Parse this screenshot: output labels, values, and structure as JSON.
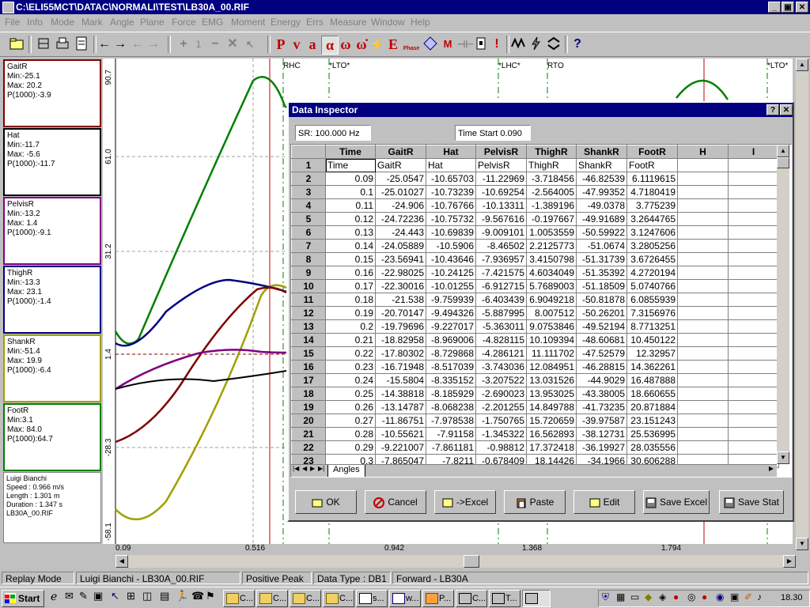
{
  "window": {
    "title": "C:\\ELI55MCT\\DATAC\\NORMALI\\TEST\\LB30A_00.RIF"
  },
  "menu": [
    "File",
    "Info",
    "Mode",
    "Mark",
    "Angle",
    "Plane",
    "Force",
    "EMG",
    "Moment",
    "Energy",
    "Errs",
    "Measure",
    "Window",
    "Help"
  ],
  "toolbar": {
    "step_value": "1",
    "tools": [
      "P",
      "v",
      "a",
      "α",
      "ω",
      "ω̇",
      "E",
      "Phase",
      "M",
      "?"
    ]
  },
  "legend": [
    {
      "name": "GaitR",
      "min": "Min:-25.1",
      "max": "Max: 20.2",
      "p": "P(1000):-3.9",
      "color": "#800000"
    },
    {
      "name": "Hat",
      "min": "Min:-11.7",
      "max": "Max: -5.6",
      "p": "P(1000):-11.7",
      "color": "#000000"
    },
    {
      "name": "PelvisR",
      "min": "Min:-13.2",
      "max": "Max: 1.4",
      "p": "P(1000):-9.1",
      "color": "#800080"
    },
    {
      "name": "ThighR",
      "min": "Min:-13.3",
      "max": "Max: 23.1",
      "p": "P(1000):-1.4",
      "color": "#000080"
    },
    {
      "name": "ShankR",
      "min": "Min:-51.4",
      "max": "Max: 19.9",
      "p": "P(1000):-6.4",
      "color": "#808000"
    },
    {
      "name": "FootR",
      "min": "Min:3.1",
      "max": "Max: 84.0",
      "p": "P(1000):64.7",
      "color": "#008000"
    }
  ],
  "subject": {
    "name": "Luigi Bianchi",
    "speed": "Speed : 0.966 m/s",
    "length": "Length : 1.301 m",
    "duration": "Duration : 1.347 s",
    "file": "LB30A_00.RIF"
  },
  "plot": {
    "y_ticks": [
      "90.7",
      "61.0",
      "31.2",
      "1.4",
      "-28.3",
      "-58.1"
    ],
    "x_ticks": [
      "0.09",
      "0.516",
      "0.942",
      "1.368",
      "1.794"
    ],
    "events": [
      "RHC",
      "*LTO*",
      "*LHC*",
      "RTO",
      "*LTO*"
    ]
  },
  "dialog": {
    "title": "Data Inspector",
    "sr": "SR: 100.000 Hz",
    "time_start": "Time Start 0.090",
    "columns": [
      "",
      "Time",
      "GaitR",
      "Hat",
      "PelvisR",
      "ThighR",
      "ShankR",
      "FootR",
      "H",
      "I"
    ],
    "header_row": [
      "Time",
      "GaitR",
      "Hat",
      "PelvisR",
      "ThighR",
      "ShankR",
      "FootR",
      "",
      ""
    ],
    "rows": [
      [
        "0.09",
        "-25.0547",
        "-10.65703",
        "-11.22969",
        "-3.718456",
        "-46.82539",
        "6.1119615"
      ],
      [
        "0.1",
        "-25.01027",
        "-10.73239",
        "-10.69254",
        "-2.564005",
        "-47.99352",
        "4.7180419"
      ],
      [
        "0.11",
        "-24.906",
        "-10.76766",
        "-10.13311",
        "-1.389196",
        "-49.0378",
        "3.775239"
      ],
      [
        "0.12",
        "-24.72236",
        "-10.75732",
        "-9.567616",
        "-0.197667",
        "-49.91689",
        "3.2644765"
      ],
      [
        "0.13",
        "-24.443",
        "-10.69839",
        "-9.009101",
        "1.0053559",
        "-50.59922",
        "3.1247606"
      ],
      [
        "0.14",
        "-24.05889",
        "-10.5906",
        "-8.46502",
        "2.2125773",
        "-51.0674",
        "3.2805256"
      ],
      [
        "0.15",
        "-23.56941",
        "-10.43646",
        "-7.936957",
        "3.4150798",
        "-51.31739",
        "3.6726455"
      ],
      [
        "0.16",
        "-22.98025",
        "-10.24125",
        "-7.421575",
        "4.6034049",
        "-51.35392",
        "4.2720194"
      ],
      [
        "0.17",
        "-22.30016",
        "-10.01255",
        "-6.912715",
        "5.7689003",
        "-51.18509",
        "5.0740766"
      ],
      [
        "0.18",
        "-21.538",
        "-9.759939",
        "-6.403439",
        "6.9049218",
        "-50.81878",
        "6.0855939"
      ],
      [
        "0.19",
        "-20.70147",
        "-9.494326",
        "-5.887995",
        "8.007512",
        "-50.26201",
        "7.3156976"
      ],
      [
        "0.2",
        "-19.79696",
        "-9.227017",
        "-5.363011",
        "9.0753846",
        "-49.52194",
        "8.7713251"
      ],
      [
        "0.21",
        "-18.82958",
        "-8.969006",
        "-4.828115",
        "10.109394",
        "-48.60681",
        "10.450122"
      ],
      [
        "0.22",
        "-17.80302",
        "-8.729868",
        "-4.286121",
        "11.111702",
        "-47.52579",
        "12.32957"
      ],
      [
        "0.23",
        "-16.71948",
        "-8.517039",
        "-3.743036",
        "12.084951",
        "-46.28815",
        "14.362261"
      ],
      [
        "0.24",
        "-15.5804",
        "-8.335152",
        "-3.207522",
        "13.031526",
        "-44.9029",
        "16.487888"
      ],
      [
        "0.25",
        "-14.38818",
        "-8.185929",
        "-2.690023",
        "13.953025",
        "-43.38005",
        "18.660655"
      ],
      [
        "0.26",
        "-13.14787",
        "-8.068238",
        "-2.201255",
        "14.849788",
        "-41.73235",
        "20.871884"
      ],
      [
        "0.27",
        "-11.86751",
        "-7.978538",
        "-1.750765",
        "15.720659",
        "-39.97587",
        "23.151243"
      ],
      [
        "0.28",
        "-10.55621",
        "-7.91158",
        "-1.345322",
        "16.562893",
        "-38.12731",
        "25.536995"
      ],
      [
        "0.29",
        "-9.221007",
        "-7.861181",
        "-0.98812",
        "17.372418",
        "-36.19927",
        "28.035556"
      ],
      [
        "0.3",
        "-7.865047",
        "-7.8211",
        "-0.678409",
        "18.14426",
        "-34.1966",
        "30.606288"
      ]
    ],
    "sheet_tab": "Angles",
    "buttons": [
      "OK",
      "Cancel",
      "->Excel",
      "Paste",
      "Edit",
      "Save Excel",
      "Save Stat"
    ]
  },
  "status": [
    "Replay Mode",
    "Luigi Bianchi - LB30A_00.RIF",
    "Positive Peak",
    "Data Type : DB1",
    "Forward - LB30A"
  ],
  "taskbar": {
    "start": "Start",
    "tasks": [
      "C...",
      "C...",
      "C...",
      "C...",
      "s...",
      "w...",
      "P...",
      "C...",
      "T...",
      ""
    ],
    "clock": "18.30"
  }
}
